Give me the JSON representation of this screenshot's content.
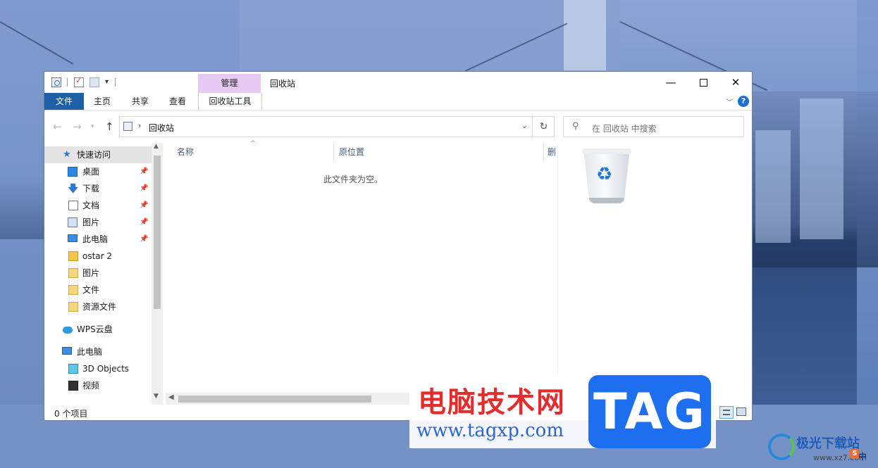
{
  "window": {
    "title": "回收站",
    "context_tab": "管理",
    "controls": {
      "minimize": "—",
      "maximize": "",
      "close": "✕"
    }
  },
  "ribbon": {
    "tabs": [
      "文件",
      "主页",
      "共享",
      "查看",
      "回收站工具"
    ],
    "help": "?"
  },
  "address": {
    "path": "回收站",
    "search_placeholder": "在 回收站 中搜索"
  },
  "nav": {
    "items": [
      {
        "label": "快速访问",
        "icon": "star-icon",
        "pinned": false
      },
      {
        "label": "桌面",
        "icon": "desktop-icon",
        "pinned": true
      },
      {
        "label": "下载",
        "icon": "download-icon",
        "pinned": true
      },
      {
        "label": "文档",
        "icon": "document-icon",
        "pinned": true
      },
      {
        "label": "图片",
        "icon": "pictures-icon",
        "pinned": true
      },
      {
        "label": "此电脑",
        "icon": "computer-icon",
        "pinned": true
      },
      {
        "label": "ostar 2",
        "icon": "user-folder-icon",
        "pinned": false
      },
      {
        "label": "图片",
        "icon": "folder-icon",
        "pinned": false
      },
      {
        "label": "文件",
        "icon": "folder-icon",
        "pinned": false
      },
      {
        "label": "资源文件",
        "icon": "folder-icon",
        "pinned": false
      },
      {
        "label": "WPS云盘",
        "icon": "cloud-icon",
        "pinned": false
      },
      {
        "label": "此电脑",
        "icon": "computer-icon",
        "pinned": false
      },
      {
        "label": "3D Objects",
        "icon": "3d-objects-icon",
        "pinned": false
      },
      {
        "label": "视频",
        "icon": "video-icon",
        "pinned": false
      }
    ]
  },
  "filelist": {
    "columns": [
      "名称",
      "原位置",
      "删"
    ],
    "empty_message": "此文件夹为空。"
  },
  "status": {
    "items_count": "0 个项目"
  },
  "watermark": {
    "site_cn": "电脑技术网",
    "url": "www.tagxp.com",
    "tag": "TAG",
    "brand2": "极光下载站",
    "brand2_url": "www.xz7.com",
    "ime": "中",
    "ime_badge": "S"
  }
}
